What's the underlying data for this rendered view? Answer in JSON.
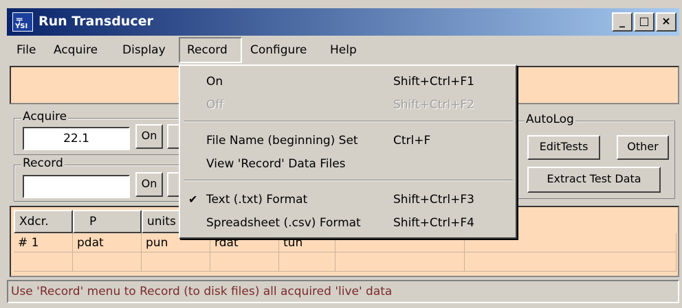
{
  "window": {
    "title": "Run Transducer",
    "icon_text": "YSI",
    "minimize": "_",
    "maximize": "□",
    "close": "×"
  },
  "menubar": [
    "File",
    "Acquire",
    "Display",
    "Record",
    "Configure",
    "Help"
  ],
  "acquire": {
    "label": "Acquire",
    "value": "22.1",
    "on_button": "On"
  },
  "record": {
    "label": "Record",
    "value": "",
    "on_button": "On"
  },
  "autolog": {
    "label": "AutoLog",
    "edit_tests": "EditTests",
    "other": "Other",
    "extract": "Extract Test Data"
  },
  "table": {
    "headers": [
      "Xdcr.",
      "P",
      "units"
    ],
    "row1": [
      "# 1",
      "pdat",
      "pun",
      "rdat",
      "tun"
    ]
  },
  "status_text": "Use 'Record' menu to Record (to disk files) all acquired 'live' data",
  "record_menu": {
    "items": [
      {
        "label": "On",
        "shortcut": "Shift+Ctrl+F1",
        "disabled": false
      },
      {
        "label": "Off",
        "shortcut": "Shift+Ctrl+F2",
        "disabled": true
      },
      {
        "label": "File Name (beginning) Set",
        "shortcut": "Ctrl+F",
        "disabled": false
      },
      {
        "label": "View 'Record' Data Files",
        "shortcut": "",
        "disabled": false
      },
      {
        "label": "Text (.txt) Format",
        "shortcut": "Shift+Ctrl+F3",
        "checked": true
      },
      {
        "label": "Spreadsheet (.csv) Format",
        "shortcut": "Shift+Ctrl+F4",
        "checked": false
      }
    ],
    "check_mark": "✔"
  },
  "colors": {
    "title_start": "#0a246a",
    "title_end": "#a6caf0",
    "panel": "#ffdab9",
    "status_text": "#7a2a2a"
  }
}
